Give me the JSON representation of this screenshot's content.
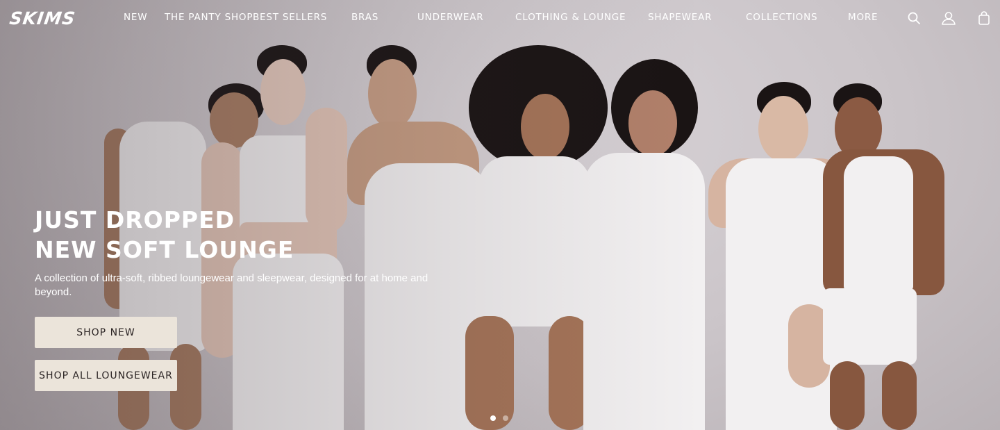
{
  "brand": {
    "logo_text": "SKIMS"
  },
  "nav": {
    "items": [
      {
        "label": "NEW"
      },
      {
        "label": "THE PANTY SHOP"
      },
      {
        "label": "BEST SELLERS"
      },
      {
        "label": "BRAS"
      },
      {
        "label": "UNDERWEAR"
      },
      {
        "label": "CLOTHING & LOUNGE"
      },
      {
        "label": "SHAPEWEAR"
      },
      {
        "label": "COLLECTIONS"
      },
      {
        "label": "MORE"
      }
    ],
    "icons": [
      "search-icon",
      "account-icon",
      "shopping-bag-icon"
    ]
  },
  "hero": {
    "headline_line1": "JUST DROPPED",
    "headline_line2": "NEW SOFT LOUNGE",
    "subcopy": "A collection of ultra-soft, ribbed loungewear and sleepwear, designed for at home and beyond.",
    "primary_button": "SHOP NEW",
    "secondary_button": "SHOP ALL LOUNGEWEAR",
    "carousel": {
      "total": 2,
      "active": 1
    }
  },
  "colors": {
    "button_bg": "#ebe4da",
    "button_text": "#2b2424",
    "nav_text": "#ffffff",
    "background": "#cfc9cd"
  }
}
